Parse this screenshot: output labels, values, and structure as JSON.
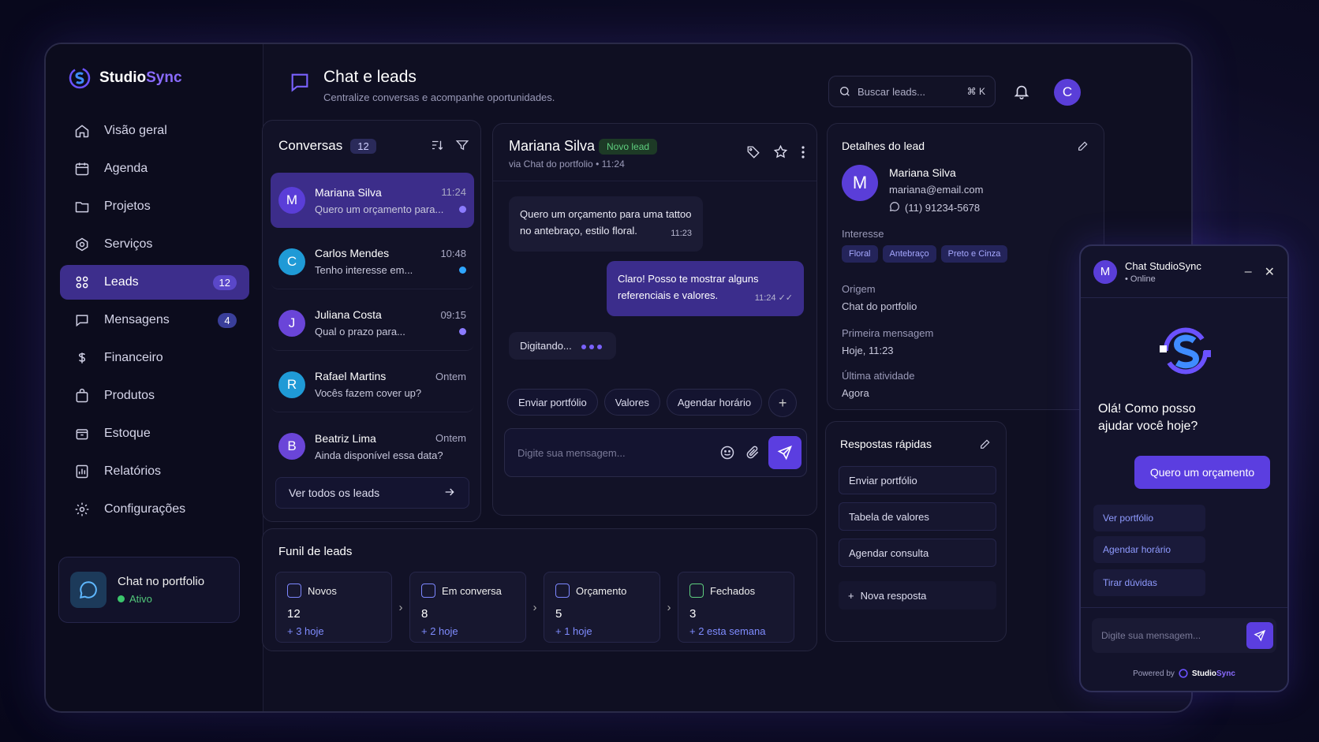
{
  "brand": {
    "name_main": "Studio",
    "name_accent": "Sync"
  },
  "sidebar": {
    "items": [
      {
        "label": "Visão geral",
        "icon": "home-icon"
      },
      {
        "label": "Agenda",
        "icon": "calendar-icon"
      },
      {
        "label": "Projetos",
        "icon": "folder-icon"
      },
      {
        "label": "Serviços",
        "icon": "services-icon"
      },
      {
        "label": "Leads",
        "icon": "leads-icon",
        "badge": "12"
      },
      {
        "label": "Mensagens",
        "icon": "message-icon",
        "badge": "4"
      },
      {
        "label": "Financeiro",
        "icon": "dollar-icon"
      },
      {
        "label": "Produtos",
        "icon": "bag-icon"
      },
      {
        "label": "Estoque",
        "icon": "box-icon"
      },
      {
        "label": "Relatórios",
        "icon": "report-icon"
      },
      {
        "label": "Configurações",
        "icon": "gear-icon"
      }
    ],
    "portfolio": {
      "title": "Chat no portfolio",
      "status": "Ativo"
    }
  },
  "header": {
    "title": "Chat e leads",
    "subtitle": "Centralize conversas e acompanhe oportunidades.",
    "search_placeholder": "Buscar leads...",
    "shortcut": "⌘ K",
    "avatar": "C"
  },
  "conversations": {
    "title": "Conversas",
    "count": "12",
    "items": [
      {
        "initial": "M",
        "name": "Mariana Silva",
        "time": "11:24",
        "message": "Quero um orçamento para...",
        "color": "#5a3ed8",
        "unread": true
      },
      {
        "initial": "C",
        "name": "Carlos Mendes",
        "time": "10:48",
        "message": "Tenho interesse em...",
        "color": "#1f9ad6",
        "unread": true
      },
      {
        "initial": "J",
        "name": "Juliana Costa",
        "time": "09:15",
        "message": "Qual o prazo para...",
        "color": "#6a45d8",
        "unread": true
      },
      {
        "initial": "R",
        "name": "Rafael Martins",
        "time": "Ontem",
        "message": "Vocês fazem cover up?",
        "color": "#1f9ad6",
        "unread": false
      },
      {
        "initial": "B",
        "name": "Beatriz Lima",
        "time": "Ontem",
        "message": "Ainda disponível essa data?",
        "color": "#6a45d8",
        "unread": false
      }
    ],
    "see_all": "Ver todos os leads"
  },
  "chat": {
    "name": "Mariana Silva",
    "badge": "Novo lead",
    "via": "via Chat do portfolio • 11:24",
    "msg_in": "Quero um orçamento para uma tattoo no antebraço, estilo floral.",
    "msg_in_time": "11:23",
    "msg_out": "Claro! Posso te mostrar alguns referenciais e valores.",
    "msg_out_time": "11:24",
    "typing": "Digitando...",
    "quick_actions": [
      "Enviar portfólio",
      "Valores",
      "Agendar horário"
    ],
    "input_placeholder": "Digite sua mensagem..."
  },
  "funnel": {
    "title": "Funil de leads",
    "stages": [
      {
        "label": "Novos",
        "count": "12",
        "delta": "+ 3 hoje"
      },
      {
        "label": "Em conversa",
        "count": "8",
        "delta": "+ 2 hoje"
      },
      {
        "label": "Orçamento",
        "count": "5",
        "delta": "+ 1 hoje"
      },
      {
        "label": "Fechados",
        "count": "3",
        "delta": "+ 2 esta semana"
      }
    ]
  },
  "details": {
    "title": "Detalhes do lead",
    "initial": "M",
    "name": "Mariana Silva",
    "email": "mariana@email.com",
    "phone": "(11) 91234-5678",
    "interest_label": "Interesse",
    "tags": [
      "Floral",
      "Antebraço",
      "Preto e Cinza"
    ],
    "origin_label": "Origem",
    "origin": "Chat do portfolio",
    "first_msg_label": "Primeira mensagem",
    "first_msg": "Hoje, 11:23",
    "last_activity_label": "Última atividade",
    "last_activity": "Agora"
  },
  "replies": {
    "title": "Respostas rápidas",
    "items": [
      "Enviar portfólio",
      "Tabela de valores",
      "Agendar consulta"
    ],
    "add": "Nova resposta"
  },
  "widget": {
    "initial": "M",
    "name": "Chat StudioSync",
    "status": "• Online",
    "greeting": "Olá! Como posso ajudar você hoje?",
    "cta": "Quero um orçamento",
    "options": [
      "Ver portfólio",
      "Agendar horário",
      "Tirar dúvidas"
    ],
    "input_placeholder": "Digite sua mensagem...",
    "powered_by": "Powered by",
    "powered_brand_main": "Studio",
    "powered_brand_accent": "Sync"
  }
}
